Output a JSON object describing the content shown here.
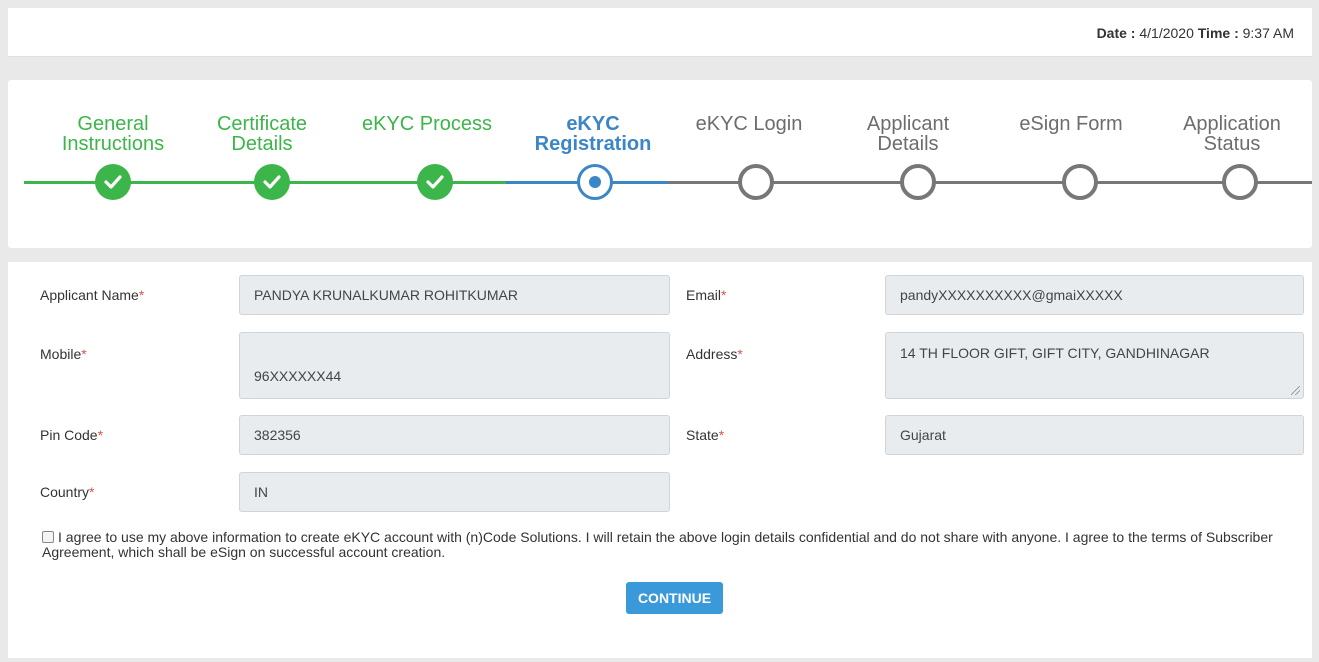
{
  "header": {
    "date_label": "Date :",
    "date_value": "4/1/2020",
    "time_label": "Time :",
    "time_value": "9:37 AM"
  },
  "steps": [
    {
      "line1": "General",
      "line2": "Instructions",
      "status": "done"
    },
    {
      "line1": "Certificate",
      "line2": "Details",
      "status": "done"
    },
    {
      "line1": "eKYC Process",
      "line2": "",
      "status": "done"
    },
    {
      "line1": "eKYC",
      "line2": "Registration",
      "status": "current"
    },
    {
      "line1": "eKYC Login",
      "line2": "",
      "status": "todo"
    },
    {
      "line1": "Applicant",
      "line2": "Details",
      "status": "todo"
    },
    {
      "line1": "eSign Form",
      "line2": "",
      "status": "todo"
    },
    {
      "line1": "Application",
      "line2": "Status",
      "status": "todo"
    }
  ],
  "colors": {
    "done": "#3cb54a",
    "current": "#3b86c6",
    "todo": "#777777",
    "button": "#3a9ad9"
  },
  "form": {
    "required_mark": "*",
    "applicant_name": {
      "label": "Applicant Name",
      "value": "PANDYA KRUNALKUMAR ROHITKUMAR"
    },
    "email": {
      "label": "Email",
      "value": "pandyXXXXXXXXXX@gmaiXXXXX"
    },
    "mobile": {
      "label": "Mobile",
      "value": "96XXXXXX44"
    },
    "address": {
      "label": "Address",
      "value": "14 TH FLOOR GIFT, GIFT CITY, GANDHINAGAR"
    },
    "pin_code": {
      "label": "Pin Code",
      "value": "382356"
    },
    "state": {
      "label": "State",
      "value": "Gujarat"
    },
    "country": {
      "label": "Country",
      "value": "IN"
    },
    "agree_text": "I agree to use my above information to create eKYC account with (n)Code Solutions. I will retain the above login details confidential and do not share with anyone. I agree to the terms of Subscriber Agreement, which shall be eSign on successful account creation.",
    "continue_label": "CONTINUE"
  }
}
